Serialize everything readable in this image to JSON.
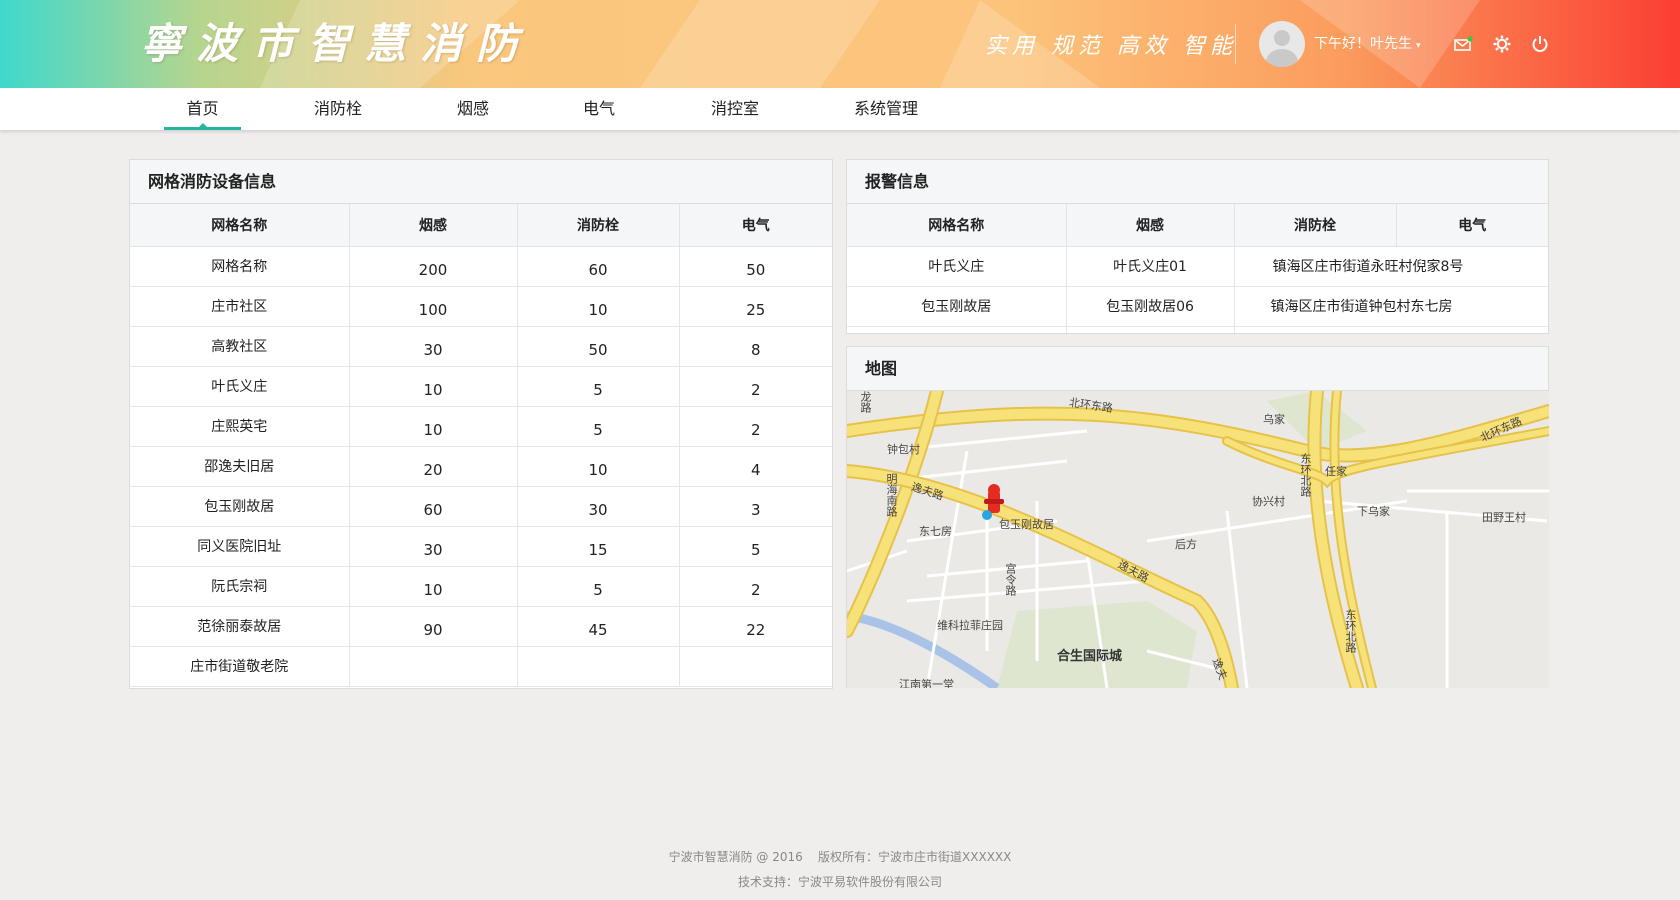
{
  "header": {
    "logo_text": "寧波市智慧消防",
    "slogans": [
      "实用",
      "规范",
      "高效",
      "智能"
    ],
    "greeting": "下午好！叶先生",
    "greeting_caret": "▾",
    "icons": [
      "mail-icon",
      "settings-gear-icon",
      "power-icon"
    ]
  },
  "nav": {
    "items": [
      {
        "label": "首页",
        "active": true
      },
      {
        "label": "消防栓",
        "active": false
      },
      {
        "label": "烟感",
        "active": false
      },
      {
        "label": "电气",
        "active": false
      },
      {
        "label": "消控室",
        "active": false
      },
      {
        "label": "系统管理",
        "active": false
      }
    ]
  },
  "grid_panel": {
    "title": "网格消防设备信息",
    "columns": [
      "网格名称",
      "烟感",
      "消防栓",
      "电气"
    ],
    "rows": [
      [
        "网格名称",
        "200",
        "60",
        "50"
      ],
      [
        "庄市社区",
        "100",
        "10",
        "25"
      ],
      [
        "高教社区",
        "30",
        "50",
        "8"
      ],
      [
        "叶氏义庄",
        "10",
        "5",
        "2"
      ],
      [
        "庄熙英宅",
        "10",
        "5",
        "2"
      ],
      [
        "邵逸夫旧居",
        "20",
        "10",
        "4"
      ],
      [
        "包玉刚故居",
        "60",
        "30",
        "3"
      ],
      [
        "同义医院旧址",
        "30",
        "15",
        "5"
      ],
      [
        "阮氏宗祠",
        "10",
        "5",
        "2"
      ],
      [
        "范徐丽泰故居",
        "90",
        "45",
        "22"
      ],
      [
        "庄市街道敬老院",
        "",
        "",
        ""
      ]
    ]
  },
  "alarm_panel": {
    "title": "报警信息",
    "columns": [
      "网格名称",
      "烟感",
      "消防栓",
      "电气"
    ],
    "rows": [
      [
        "叶氏义庄",
        "叶氏义庄01",
        "镇海区庄市街道永旺村倪家8号"
      ],
      [
        "包玉刚故居",
        "包玉刚故居06",
        "镇海区庄市街道钟包村东七房"
      ]
    ]
  },
  "map_panel": {
    "title": "地图",
    "labels": {
      "road_beihuan_top": "北环东路",
      "road_beihuan_right": "北环东路",
      "village_wujia": "乌家",
      "road_donghuan_upper": "东环北路",
      "village_renjia": "任家",
      "village_zhongbao": "钟包村",
      "road_minghai": "明海南路",
      "road_yifu_upper": "逸夫路",
      "road_longpart": "龙路",
      "village_xiexing": "协兴村",
      "village_xiawujia": "下乌家",
      "village_tianye": "田野王村",
      "poi_baoyugang": "包玉刚故居",
      "village_dongqifang": "东七房",
      "village_houfang": "后方",
      "road_yifu_lower": "逸夫路",
      "road_gongling": "宫令路",
      "road_donghuan_lower": "东环北路",
      "poi_weikela": "维科拉菲庄园",
      "poi_hesheng": "合生国际城",
      "poi_jiangnan": "江南第一堂",
      "road_yi_edge": "逸夫"
    },
    "marker": "fire-hydrant-marker-icon",
    "colors": {
      "road_major": "#f7e27a",
      "road_edge": "#e6c24a",
      "water": "#a9c3e8",
      "land": "#ebe9e5",
      "park": "#dfe6cf"
    }
  },
  "footer": {
    "line1": "宁波市智慧消防 @ 2016    版权所有：宁波市庄市街道XXXXXX",
    "line2": "技术支持：宁波平易软件股份有限公司"
  },
  "colors": {
    "accent": "#27b49c",
    "header_left": "#3fd8cc",
    "header_mid": "#fcc57e",
    "header_right": "#fb3e32",
    "background": "#efeeed"
  }
}
